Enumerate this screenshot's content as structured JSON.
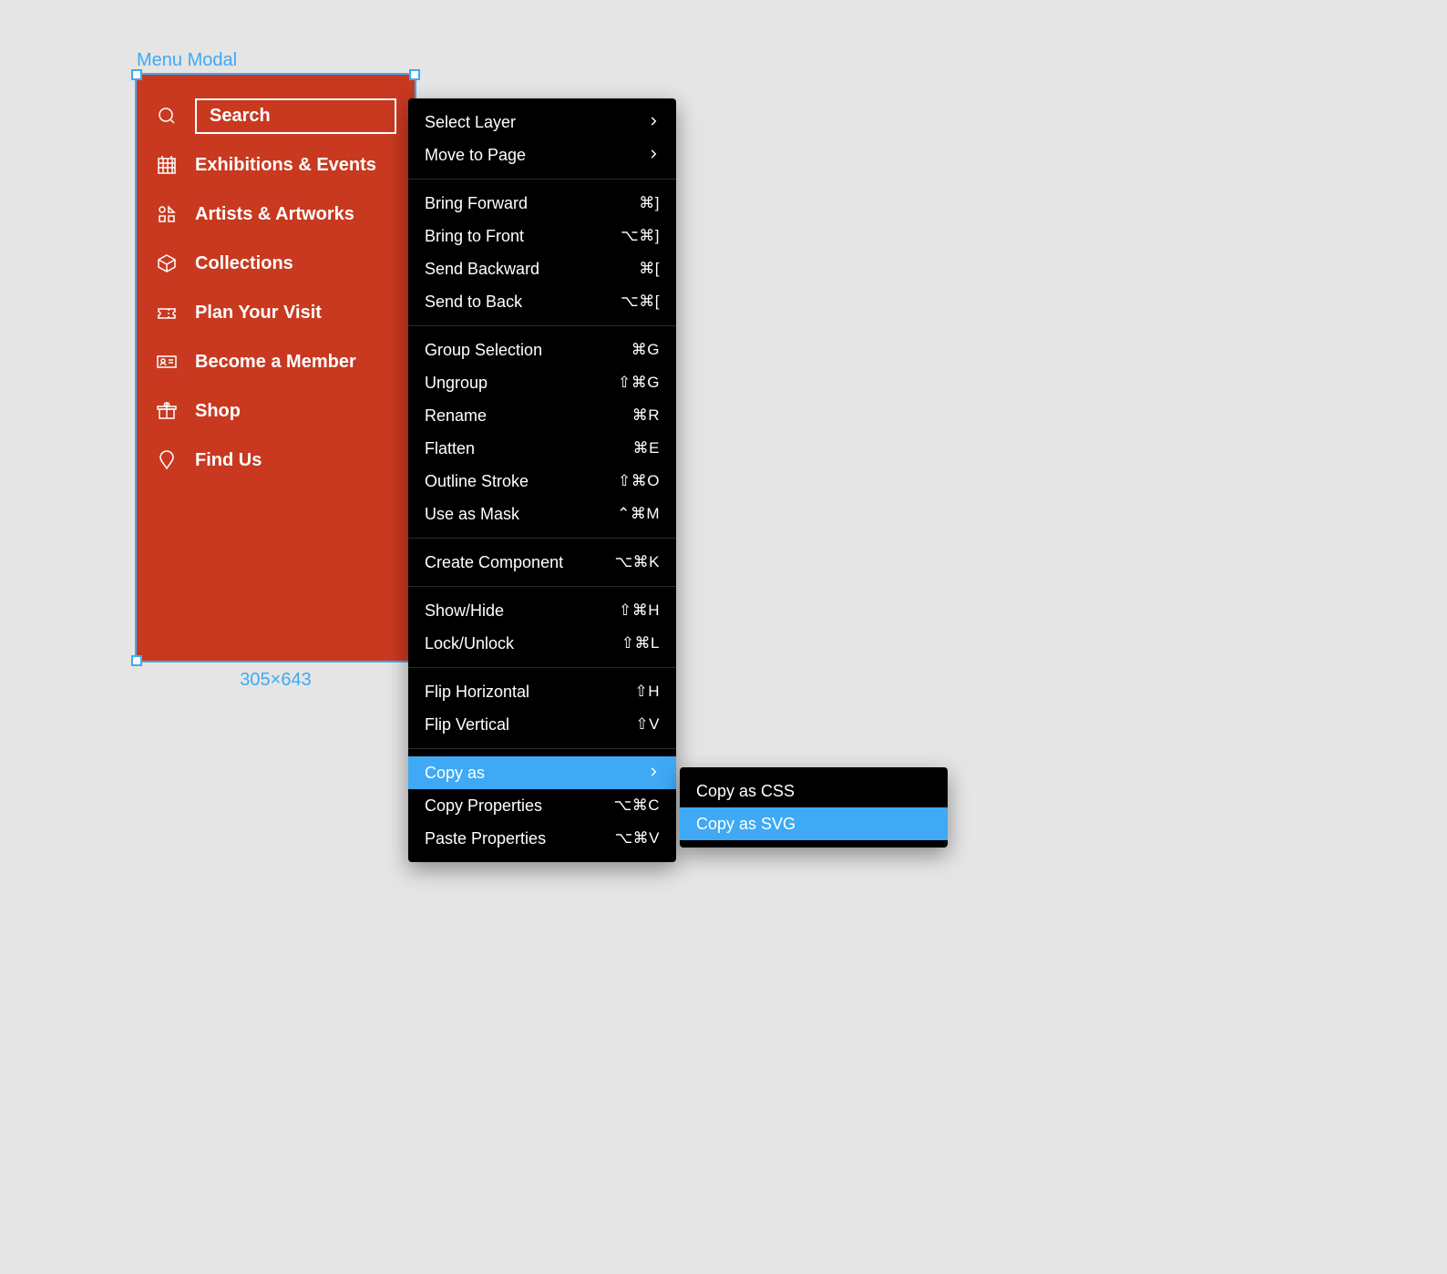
{
  "frame": {
    "label": "Menu Modal",
    "dimensions": "305×643"
  },
  "menu": {
    "search": "Search",
    "items": [
      "Exhibitions & Events",
      "Artists & Artworks",
      "Collections",
      "Plan Your Visit",
      "Become a Member",
      "Shop",
      "Find Us"
    ]
  },
  "context": {
    "groups": [
      [
        {
          "label": "Select Layer",
          "type": "submenu"
        },
        {
          "label": "Move to Page",
          "type": "submenu"
        }
      ],
      [
        {
          "label": "Bring Forward",
          "shortcut": "⌘]"
        },
        {
          "label": "Bring to Front",
          "shortcut": "⌥⌘]"
        },
        {
          "label": "Send Backward",
          "shortcut": "⌘["
        },
        {
          "label": "Send to Back",
          "shortcut": "⌥⌘["
        }
      ],
      [
        {
          "label": "Group Selection",
          "shortcut": "⌘G"
        },
        {
          "label": "Ungroup",
          "shortcut": "⇧⌘G"
        },
        {
          "label": "Rename",
          "shortcut": "⌘R"
        },
        {
          "label": "Flatten",
          "shortcut": "⌘E"
        },
        {
          "label": "Outline Stroke",
          "shortcut": "⇧⌘O"
        },
        {
          "label": "Use as Mask",
          "shortcut": "⌃⌘M"
        }
      ],
      [
        {
          "label": "Create Component",
          "shortcut": "⌥⌘K"
        }
      ],
      [
        {
          "label": "Show/Hide",
          "shortcut": "⇧⌘H"
        },
        {
          "label": "Lock/Unlock",
          "shortcut": "⇧⌘L"
        }
      ],
      [
        {
          "label": "Flip Horizontal",
          "shortcut": "⇧H"
        },
        {
          "label": "Flip Vertical",
          "shortcut": "⇧V"
        }
      ],
      [
        {
          "label": "Copy as",
          "type": "submenu",
          "highlighted": true
        },
        {
          "label": "Copy Properties",
          "shortcut": "⌥⌘C"
        },
        {
          "label": "Paste Properties",
          "shortcut": "⌥⌘V"
        }
      ]
    ]
  },
  "submenu": [
    {
      "label": "Copy as CSS"
    },
    {
      "label": "Copy as SVG",
      "highlighted": true
    }
  ]
}
